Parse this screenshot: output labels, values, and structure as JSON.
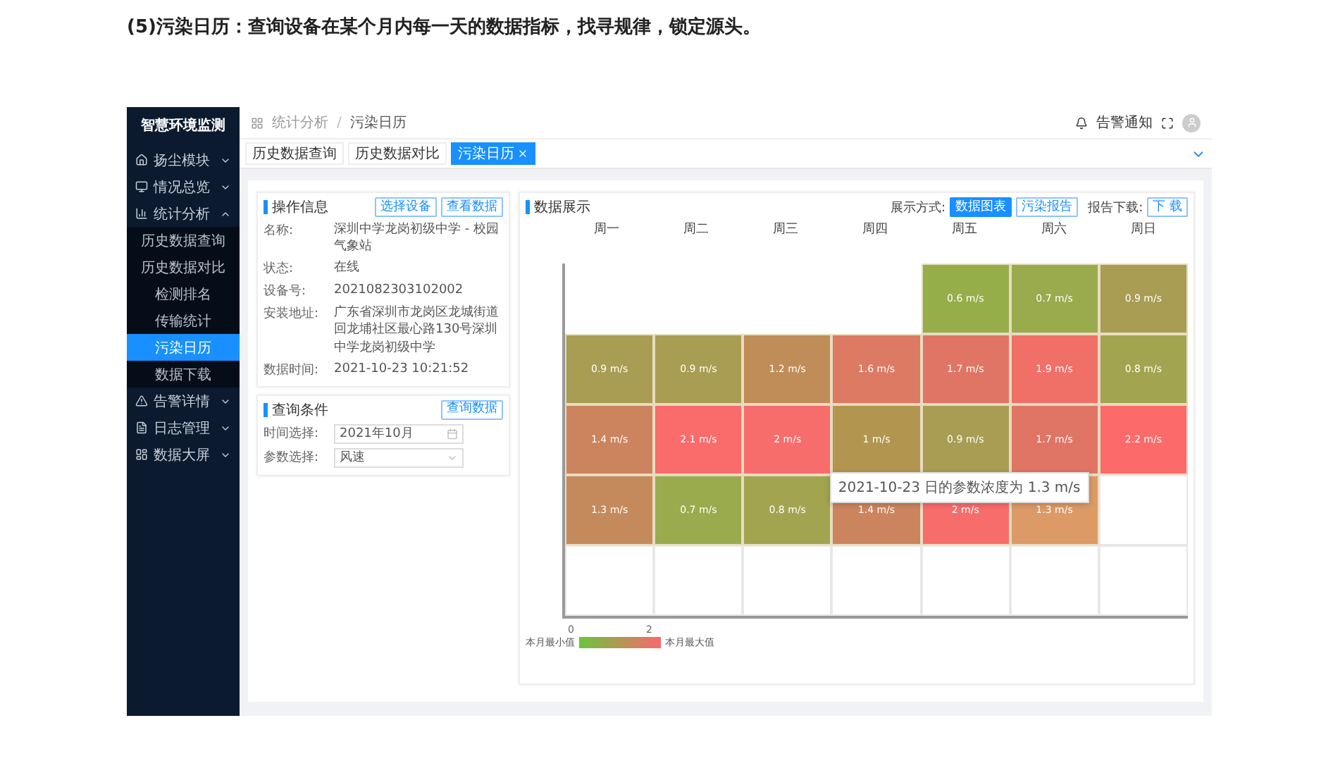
{
  "heading": "(5)污染日历：查询设备在某个月内每一天的数据指标，找寻规律，锁定源头。",
  "sidebar": {
    "title": "智慧环境监测",
    "items": [
      {
        "label": "扬尘模块",
        "expanded": false
      },
      {
        "label": "情况总览",
        "expanded": false
      },
      {
        "label": "统计分析",
        "expanded": true,
        "children": [
          {
            "label": "历史数据查询",
            "selected": false
          },
          {
            "label": "历史数据对比",
            "selected": false
          },
          {
            "label": "检测排名",
            "selected": false
          },
          {
            "label": "传输统计",
            "selected": false
          },
          {
            "label": "污染日历",
            "selected": true
          },
          {
            "label": "数据下载",
            "selected": false
          }
        ]
      },
      {
        "label": "告警详情",
        "expanded": false
      },
      {
        "label": "日志管理",
        "expanded": false
      },
      {
        "label": "数据大屏",
        "expanded": false
      }
    ]
  },
  "breadcrumb": [
    "统计分析",
    "污染日历"
  ],
  "breadcrumb_separator": "/",
  "header": {
    "notice": "告警通知"
  },
  "tabs": [
    {
      "label": "历史数据查询",
      "selected": false,
      "closable": false
    },
    {
      "label": "历史数据对比",
      "selected": false,
      "closable": false
    },
    {
      "label": "污染日历",
      "selected": true,
      "closable": true
    }
  ],
  "info_panel": {
    "title": "操作信息",
    "buttons": [
      "选择设备",
      "查看数据"
    ],
    "fields": [
      {
        "label": "名称:",
        "value": "深圳中学龙岗初级中学 - 校园气象站"
      },
      {
        "label": "状态:",
        "value": "在线"
      },
      {
        "label": "设备号:",
        "value": "2021082303102002"
      },
      {
        "label": "安装地址:",
        "value": "广东省深圳市龙岗区龙城街道回龙埔社区最心路130号深圳中学龙岗初级中学"
      },
      {
        "label": "数据时间:",
        "value": "2021-10-23 10:21:52"
      }
    ]
  },
  "query_panel": {
    "title": "查询条件",
    "button": "查询数据",
    "fields": [
      {
        "label": "时间选择:",
        "value": "2021年10月",
        "kind": "date"
      },
      {
        "label": "参数选择:",
        "value": "风速",
        "kind": "select"
      }
    ]
  },
  "data_panel": {
    "title": "数据展示",
    "mode_label": "展示方式:",
    "modes": [
      {
        "label": "数据图表",
        "selected": true
      },
      {
        "label": "污染报告",
        "selected": false
      }
    ],
    "download_label": "报告下载:",
    "download_button": "下 载",
    "weekdays": [
      "周一",
      "周二",
      "周三",
      "周四",
      "周五",
      "周六",
      "周日"
    ],
    "weeks": [
      [
        {
          "kind": "pad"
        },
        {
          "kind": "pad"
        },
        {
          "kind": "pad"
        },
        {
          "kind": "pad"
        },
        {
          "kind": "day",
          "value": "0.6 m/s",
          "color": "#95ae4a"
        },
        {
          "kind": "day",
          "value": "0.7 m/s",
          "color": "#9aab4d"
        },
        {
          "kind": "day",
          "value": "0.9 m/s",
          "color": "#a89d52"
        }
      ],
      [
        {
          "kind": "day",
          "value": "0.9 m/s",
          "color": "#a89d52"
        },
        {
          "kind": "day",
          "value": "0.9 m/s",
          "color": "#a89d52"
        },
        {
          "kind": "day",
          "value": "1.2 m/s",
          "color": "#c08c57"
        },
        {
          "kind": "day",
          "value": "1.6 m/s",
          "color": "#dc7a63"
        },
        {
          "kind": "day",
          "value": "1.7 m/s",
          "color": "#e07565"
        },
        {
          "kind": "day",
          "value": "1.9 m/s",
          "color": "#f07068"
        },
        {
          "kind": "day",
          "value": "0.8 m/s",
          "color": "#a3a450"
        }
      ],
      [
        {
          "kind": "day",
          "value": "1.4 m/s",
          "color": "#cc845e"
        },
        {
          "kind": "day",
          "value": "2.1 m/s",
          "color": "#fa6b6b"
        },
        {
          "kind": "day",
          "value": "2 m/s",
          "color": "#f76d6c"
        },
        {
          "kind": "day",
          "value": "1 m/s",
          "color": "#b2954f"
        },
        {
          "kind": "day",
          "value": "0.9 m/s",
          "color": "#a89d52"
        },
        {
          "kind": "day",
          "value": "1.7 m/s",
          "color": "#e07565"
        },
        {
          "kind": "day",
          "value": "2.2 m/s",
          "color": "#fc6a6a"
        }
      ],
      [
        {
          "kind": "day",
          "value": "1.3 m/s",
          "color": "#c58a5c"
        },
        {
          "kind": "day",
          "value": "0.7 m/s",
          "color": "#9aab4d"
        },
        {
          "kind": "day",
          "value": "0.8 m/s",
          "color": "#a3a450"
        },
        {
          "kind": "day",
          "value": "1.4 m/s",
          "color": "#cc845e"
        },
        {
          "kind": "day",
          "value": "2 m/s",
          "color": "#f76d6c"
        },
        {
          "kind": "day",
          "value": "1.3 m/s",
          "color": "#dc9a66",
          "tooltip": "2021-10-23 日的参数浓度为 1.3 m/s"
        },
        {
          "kind": "empty"
        }
      ],
      [
        {
          "kind": "empty"
        },
        {
          "kind": "empty"
        },
        {
          "kind": "empty"
        },
        {
          "kind": "empty"
        },
        {
          "kind": "empty"
        },
        {
          "kind": "empty"
        },
        {
          "kind": "empty"
        }
      ]
    ],
    "legend": {
      "min_tick": "0",
      "max_tick": "2",
      "min_label": "本月最小值",
      "max_label": "本月最大值"
    }
  }
}
